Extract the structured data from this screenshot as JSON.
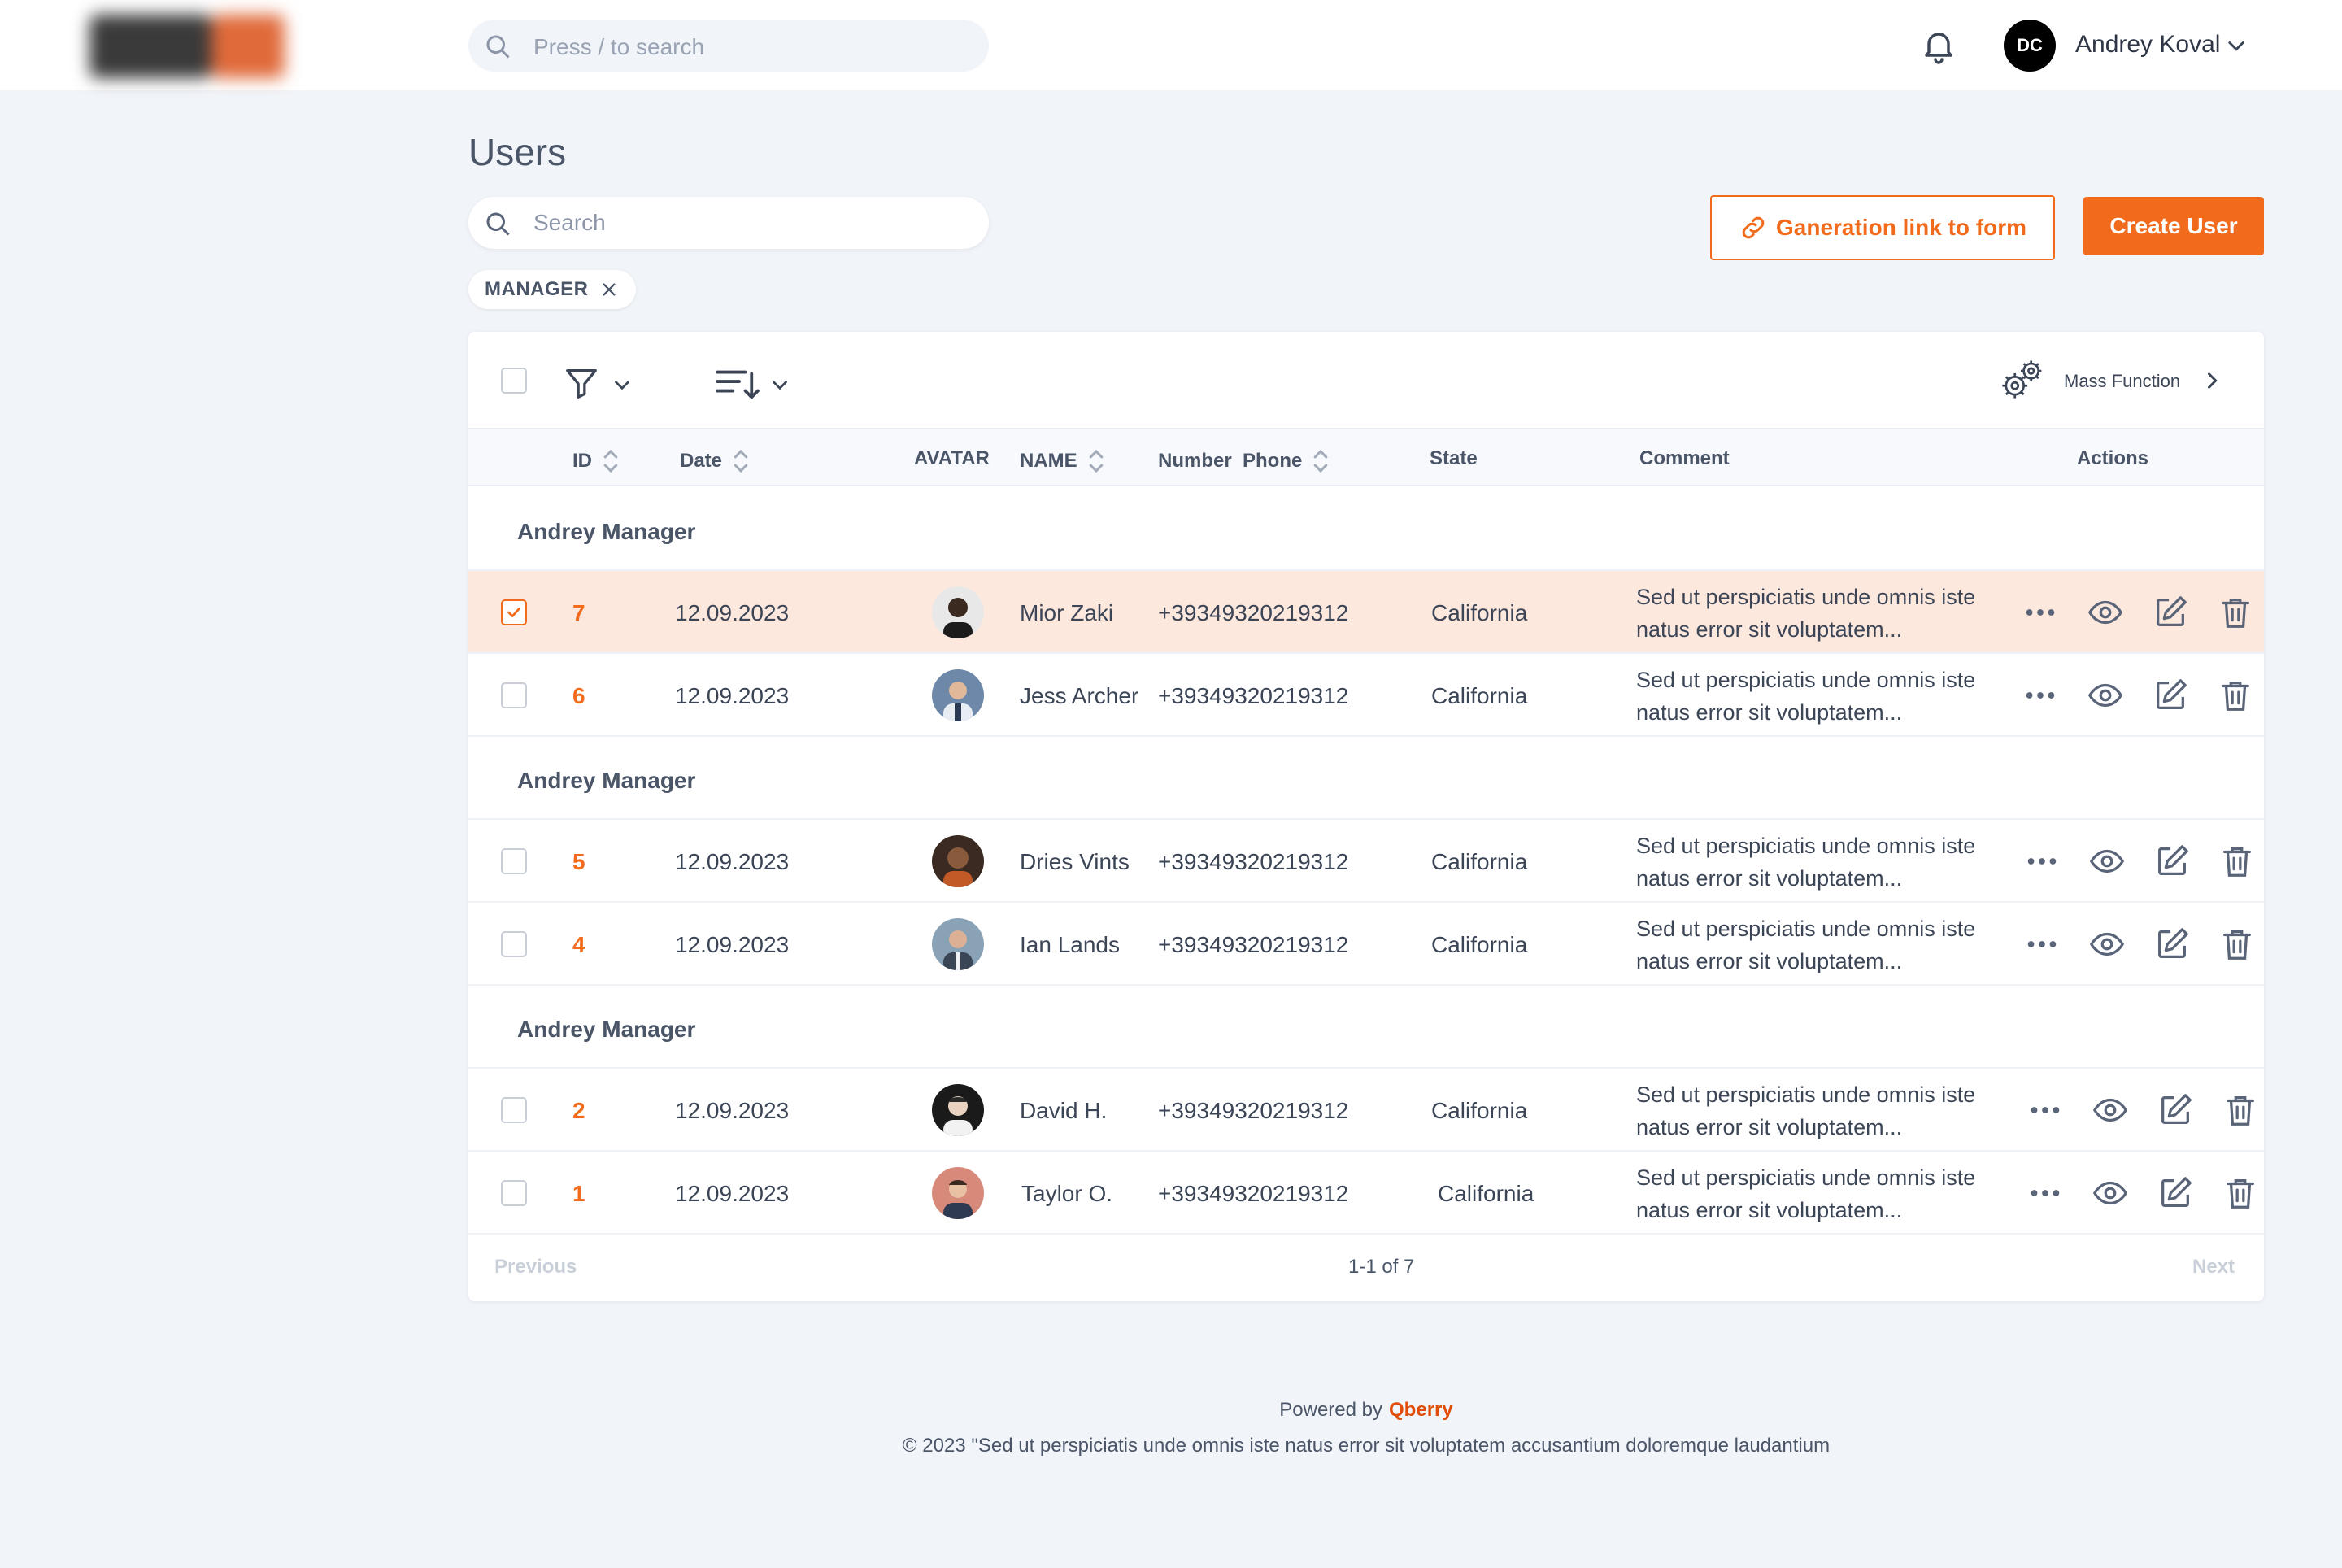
{
  "topbar": {
    "search_placeholder": "Press / to search",
    "avatar_initials": "DC",
    "user_name": "Andrey Koval"
  },
  "page": {
    "title": "Users",
    "search_placeholder": "Search",
    "filter_chip": "MANAGER",
    "generate_link_label": "Ganeration link to form",
    "create_user_label": "Create User"
  },
  "toolbar": {
    "mass_function_label": "Mass Function"
  },
  "table": {
    "columns": {
      "id": "ID",
      "date": "Date",
      "avatar": "AVATAR",
      "name": "NAME",
      "phone": "Number  Phone",
      "state": "State",
      "comment": "Comment",
      "actions": "Actions"
    },
    "groups": [
      {
        "label": "Andrey Manager",
        "rows": [
          {
            "id": "7",
            "date": "12.09.2023",
            "name": "Mior Zaki",
            "phone": "+39349320219312",
            "state": "California",
            "comment": "Sed ut perspiciatis unde omnis iste natus error sit voluptatem...",
            "selected": true
          },
          {
            "id": "6",
            "date": "12.09.2023",
            "name": "Jess Archer",
            "phone": "+39349320219312",
            "state": "California",
            "comment": "Sed ut perspiciatis unde omnis iste natus error sit voluptatem...",
            "selected": false
          }
        ]
      },
      {
        "label": "Andrey Manager",
        "rows": [
          {
            "id": "5",
            "date": "12.09.2023",
            "name": "Dries Vints",
            "phone": "+39349320219312",
            "state": "California",
            "comment": "Sed ut perspiciatis unde omnis iste natus error sit voluptatem...",
            "selected": false
          },
          {
            "id": "4",
            "date": "12.09.2023",
            "name": "Ian Lands",
            "phone": "+39349320219312",
            "state": "California",
            "comment": "Sed ut perspiciatis unde omnis iste natus error sit voluptatem...",
            "selected": false
          }
        ]
      },
      {
        "label": "Andrey Manager",
        "rows": [
          {
            "id": "2",
            "date": "12.09.2023",
            "name": "David H.",
            "phone": "+39349320219312",
            "state": "California",
            "comment": "Sed ut perspiciatis unde omnis iste natus error sit voluptatem...",
            "selected": false
          },
          {
            "id": "1",
            "date": "12.09.2023",
            "name": "Taylor O.",
            "phone": "+39349320219312",
            "state": "California",
            "comment": "Sed ut perspiciatis unde omnis iste natus error sit voluptatem...",
            "selected": false
          }
        ]
      }
    ]
  },
  "pagination": {
    "previous": "Previous",
    "info": "1-1 of 7",
    "next": "Next"
  },
  "footer": {
    "powered_by": "Powered by",
    "brand": "Qberry",
    "copyright": "© 2023 \"Sed ut perspiciatis unde omnis iste natus error sit voluptatem accusantium doloremque laudantium"
  },
  "colors": {
    "accent": "#f26b1d",
    "selected_row": "#fde8de",
    "background": "#f1f4f9"
  },
  "icons": {
    "search": "search-icon",
    "bell": "bell-icon",
    "filter": "filter-icon",
    "sort": "sort-icon",
    "gears": "gears-icon",
    "link": "link-icon",
    "more": "more-icon",
    "view": "eye-icon",
    "edit": "edit-icon",
    "delete": "trash-icon"
  }
}
